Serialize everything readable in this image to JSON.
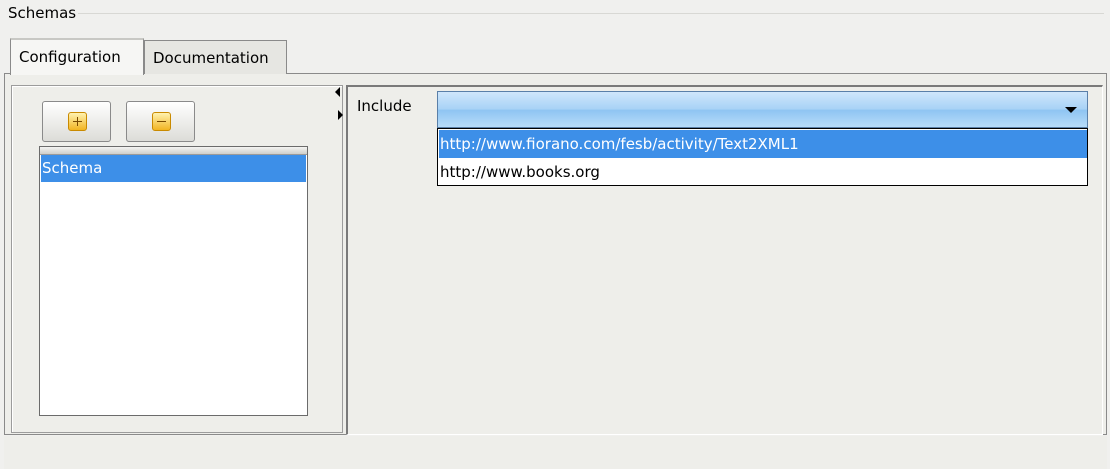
{
  "group": {
    "title": "Schemas"
  },
  "tabs": [
    {
      "label": "Configuration",
      "selected": true
    },
    {
      "label": "Documentation",
      "selected": false
    }
  ],
  "toolbar": {
    "add_icon": "plus-icon",
    "remove_icon": "minus-icon"
  },
  "schema_list": {
    "items": [
      {
        "label": "Schema",
        "selected": true
      }
    ]
  },
  "include": {
    "label": "Include",
    "value": "",
    "options": [
      "http://www.fiorano.com/fesb/activity/Text2XML1",
      "http://www.books.org"
    ],
    "highlighted_index": 0
  },
  "colors": {
    "selection": "#3d8fe8",
    "combo_gradient_top": "#cfe6fb",
    "combo_gradient_bottom": "#8ec4f2",
    "icon_fill": "#f2b422"
  }
}
